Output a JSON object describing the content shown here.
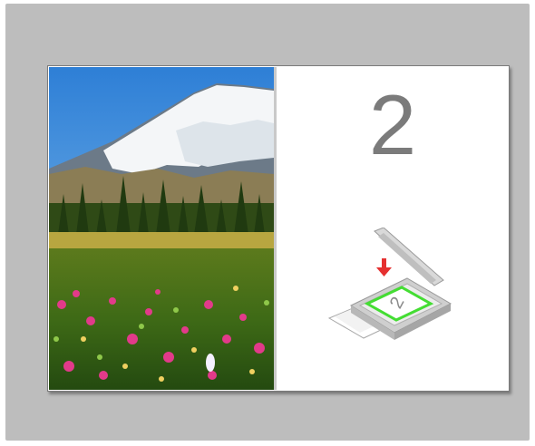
{
  "step": {
    "number": "2"
  },
  "photo": {
    "description_icon": "landscape-photo"
  },
  "scanner": {
    "icon": "flatbed-scanner-icon",
    "arrow_icon": "placement-arrow-icon",
    "page_glyph": "2",
    "colors": {
      "arrow": "#e53030",
      "placement_frame": "#44dd33",
      "body": "#bfbfbf"
    }
  },
  "colors": {
    "background": "#bdbdbd",
    "panel": "#ffffff",
    "number": "#7b7b7b"
  }
}
